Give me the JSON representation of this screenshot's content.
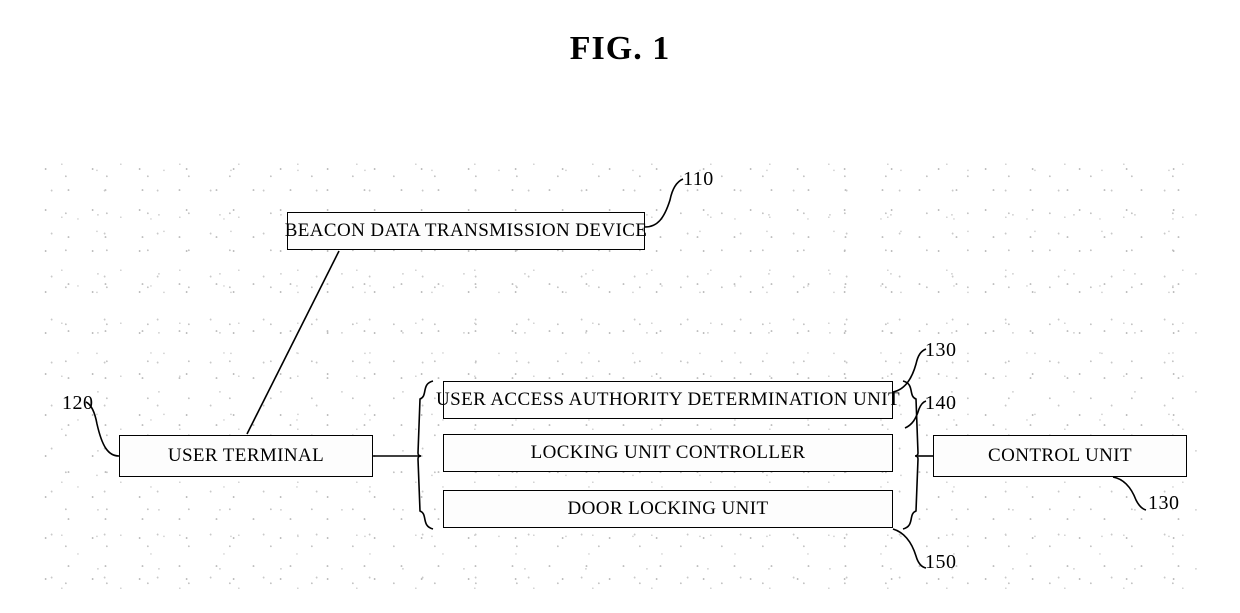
{
  "figure": {
    "title": "FIG. 1",
    "type": "block-diagram"
  },
  "blocks": [
    {
      "id": "beacon",
      "label": "BEACON DATA TRANSMISSION DEVICE"
    },
    {
      "id": "terminal",
      "label": "USER TERMINAL"
    },
    {
      "id": "auth",
      "label": "USER ACCESS AUTHORITY DETERMINATION UNIT"
    },
    {
      "id": "locking",
      "label": "LOCKING UNIT CONTROLLER"
    },
    {
      "id": "door",
      "label": "DOOR LOCKING UNIT"
    },
    {
      "id": "control",
      "label": "CONTROL UNIT"
    }
  ],
  "reference_numerals": [
    {
      "id": "ref-110",
      "value": "110"
    },
    {
      "id": "ref-120",
      "value": "120"
    },
    {
      "id": "ref-130",
      "value": "130"
    },
    {
      "id": "ref-140",
      "value": "140"
    },
    {
      "id": "ref-130b",
      "value": "130"
    },
    {
      "id": "ref-150",
      "value": "150"
    }
  ],
  "colors": {
    "line": "#000000",
    "background": "#ffffff",
    "speckle": "#c4c4c4"
  }
}
